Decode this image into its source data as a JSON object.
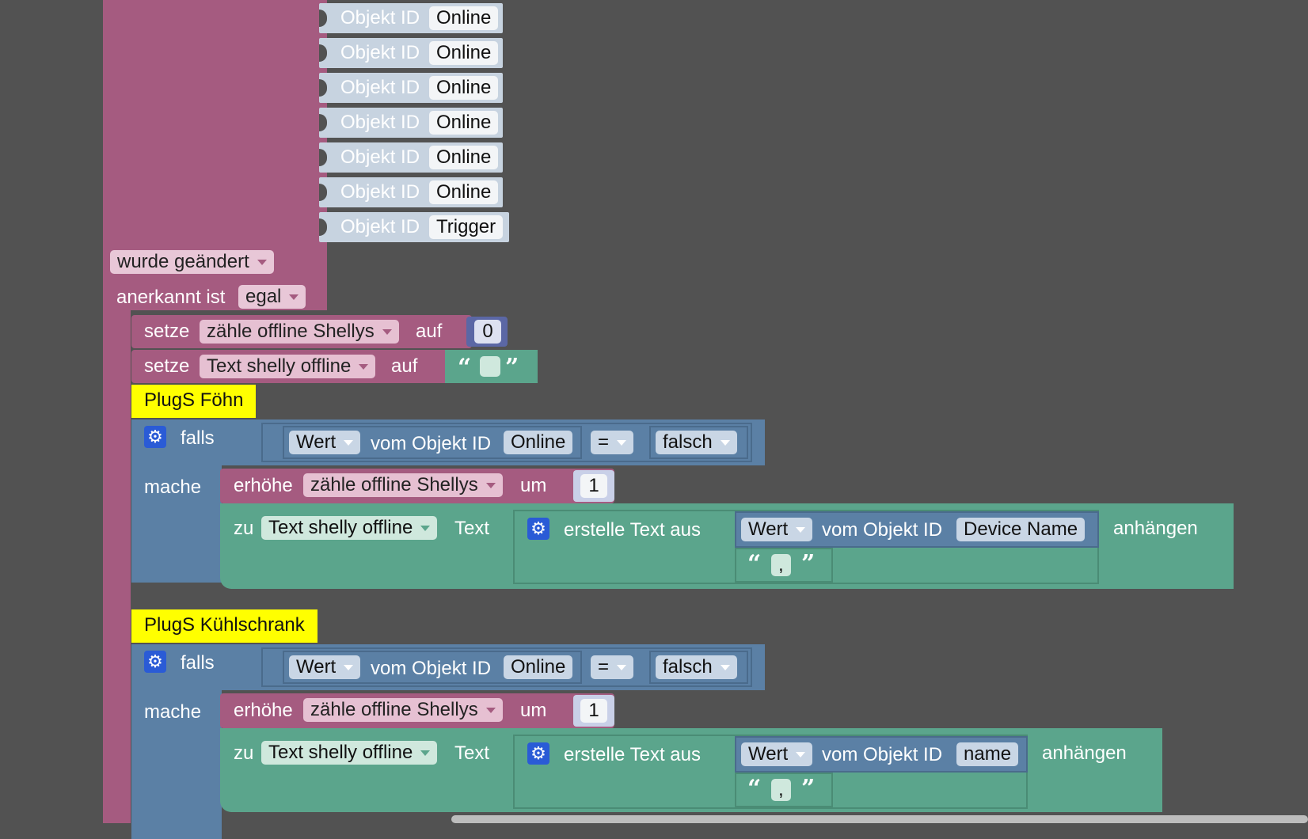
{
  "trigger": {
    "object_ids": [
      {
        "label": "Objekt ID",
        "value": "Online"
      },
      {
        "label": "Objekt ID",
        "value": "Online"
      },
      {
        "label": "Objekt ID",
        "value": "Online"
      },
      {
        "label": "Objekt ID",
        "value": "Online"
      },
      {
        "label": "Objekt ID",
        "value": "Online"
      },
      {
        "label": "Objekt ID",
        "value": "Online"
      },
      {
        "label": "Objekt ID",
        "value": "Trigger"
      }
    ],
    "change_dropdown": "wurde geändert",
    "ack_label": "anerkannt ist",
    "ack_dropdown": "egal"
  },
  "set1": {
    "setze": "setze",
    "var": "zähle offline Shellys",
    "auf": "auf",
    "value": "0"
  },
  "set2": {
    "setze": "setze",
    "var": "Text shelly offline",
    "auf": "auf",
    "value": ""
  },
  "groups": [
    {
      "comment": "PlugS Föhn",
      "falls": "falls",
      "wert": "Wert",
      "vom": "vom Objekt ID",
      "obj": "Online",
      "op": "=",
      "cmp": "falsch",
      "mache": "mache",
      "inc_label": "erhöhe",
      "inc_var": "zähle offline Shellys",
      "inc_um": "um",
      "inc_val": "1",
      "zu": "zu",
      "text_var": "Text shelly offline",
      "text_label": "Text",
      "create": "erstelle Text aus",
      "wert2": "Wert",
      "vom2": "vom Objekt ID",
      "obj2": "Device Name",
      "append": "anhängen",
      "sep": ","
    },
    {
      "comment": "PlugS Kühlschrank",
      "falls": "falls",
      "wert": "Wert",
      "vom": "vom Objekt ID",
      "obj": "Online",
      "op": "=",
      "cmp": "falsch",
      "mache": "mache",
      "inc_label": "erhöhe",
      "inc_var": "zähle offline Shellys",
      "inc_um": "um",
      "inc_val": "1",
      "zu": "zu",
      "text_var": "Text shelly offline",
      "text_label": "Text",
      "create": "erstelle Text aus",
      "wert2": "Wert",
      "vom2": "vom Objekt ID",
      "obj2": "name",
      "append": "anhängen",
      "sep": ","
    }
  ],
  "icons": {
    "gear": "gear-icon",
    "dropdown": "chevron-down-icon"
  }
}
